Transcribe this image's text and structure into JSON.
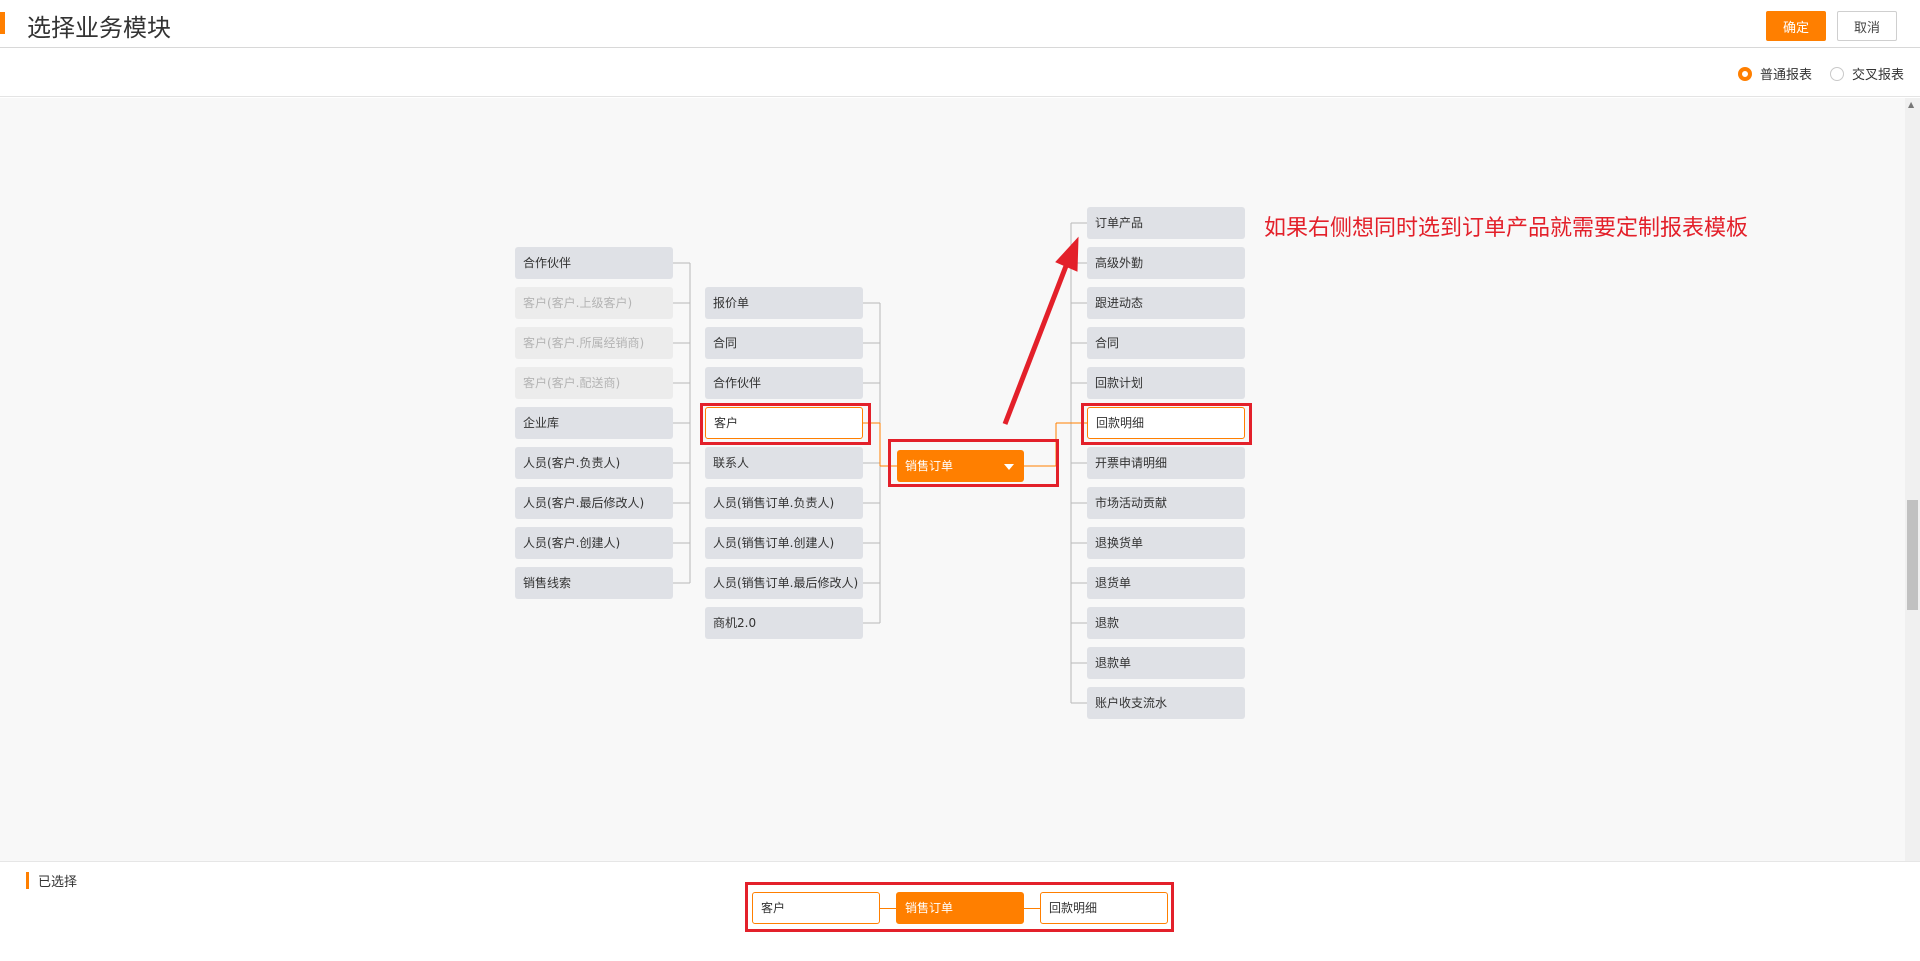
{
  "header": {
    "title": "选择业务模块",
    "confirm_label": "确定",
    "cancel_label": "取消"
  },
  "report_type": {
    "options": [
      {
        "label": "普通报表",
        "checked": true
      },
      {
        "label": "交叉报表",
        "checked": false
      }
    ]
  },
  "left_column": [
    {
      "label": "合作伙伴",
      "disabled": false
    },
    {
      "label": "客户(客户.上级客户)",
      "disabled": true
    },
    {
      "label": "客户(客户.所属经销商)",
      "disabled": true
    },
    {
      "label": "客户(客户.配送商)",
      "disabled": true
    },
    {
      "label": "企业库",
      "disabled": false
    },
    {
      "label": "人员(客户.负责人)",
      "disabled": false
    },
    {
      "label": "人员(客户.最后修改人)",
      "disabled": false
    },
    {
      "label": "人员(客户.创建人)",
      "disabled": false
    },
    {
      "label": "销售线索",
      "disabled": false
    }
  ],
  "middle_column": [
    {
      "label": "报价单"
    },
    {
      "label": "合同"
    },
    {
      "label": "合作伙伴"
    },
    {
      "label": "客户",
      "selected": true
    },
    {
      "label": "联系人"
    },
    {
      "label": "人员(销售订单.负责人)"
    },
    {
      "label": "人员(销售订单.创建人)"
    },
    {
      "label": "人员(销售订单.最后修改人)"
    },
    {
      "label": "商机2.0"
    }
  ],
  "center_node": {
    "label": "销售订单",
    "icon": "caret-down-icon"
  },
  "right_column": [
    {
      "label": "订单产品"
    },
    {
      "label": "高级外勤"
    },
    {
      "label": "跟进动态"
    },
    {
      "label": "合同"
    },
    {
      "label": "回款计划"
    },
    {
      "label": "回款明细",
      "selected": true
    },
    {
      "label": "开票申请明细"
    },
    {
      "label": "市场活动贡献"
    },
    {
      "label": "退换货单"
    },
    {
      "label": "退货单"
    },
    {
      "label": "退款"
    },
    {
      "label": "退款单"
    },
    {
      "label": "账户收支流水"
    }
  ],
  "annotation": "如果右侧想同时选到订单产品就需要定制报表模板",
  "selected_section": {
    "label": "已选择",
    "chips": [
      {
        "label": "客户",
        "style": "outline"
      },
      {
        "label": "销售订单",
        "style": "filled"
      },
      {
        "label": "回款明细",
        "style": "outline"
      }
    ]
  },
  "colors": {
    "accent": "#ff7f00",
    "annotation_red": "#e3202a",
    "node_bg": "#dfe1e6"
  }
}
